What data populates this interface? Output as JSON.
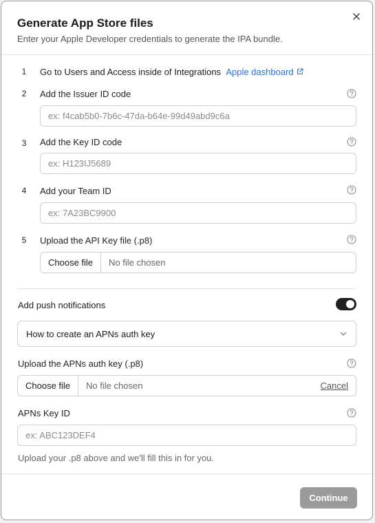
{
  "dialog": {
    "title": "Generate App Store files",
    "subtitle": "Enter your Apple Developer credentials to generate the IPA bundle."
  },
  "steps": [
    {
      "number": "1",
      "prefix": "Go to ",
      "bold1": "Users and Access",
      "middle": " inside of ",
      "bold2": "Integrations",
      "link": "Apple dashboard"
    },
    {
      "number": "2",
      "label": "Add the Issuer ID code",
      "placeholder": "ex: f4cab5b0-7b6c-47da-b64e-99d49abd9c6a",
      "value": ""
    },
    {
      "number": "3",
      "label": "Add the Key ID code",
      "placeholder": "ex: H123IJ5689",
      "value": ""
    },
    {
      "number": "4",
      "label": "Add your Team ID",
      "placeholder": "ex: 7A23BC9900",
      "value": ""
    },
    {
      "number": "5",
      "label": "Upload the API Key file (.p8)",
      "choose_label": "Choose file",
      "file_status": "No file chosen"
    }
  ],
  "push": {
    "label": "Add push notifications",
    "enabled": true,
    "accordion_label": "How to create an APNs auth key",
    "upload_label": "Upload the APNs auth key (.p8)",
    "choose_label": "Choose file",
    "file_status": "No file chosen",
    "cancel_label": "Cancel",
    "key_id_label": "APNs Key ID",
    "key_id_placeholder": "ex: ABC123DEF4",
    "key_id_value": "",
    "hint": "Upload your .p8 above and we'll fill this in for you."
  },
  "footer": {
    "continue_label": "Continue"
  },
  "colors": {
    "link": "#2c6fd6",
    "toggle_on": "#1f1f1f",
    "continue_disabled": "#9b9b9b"
  }
}
